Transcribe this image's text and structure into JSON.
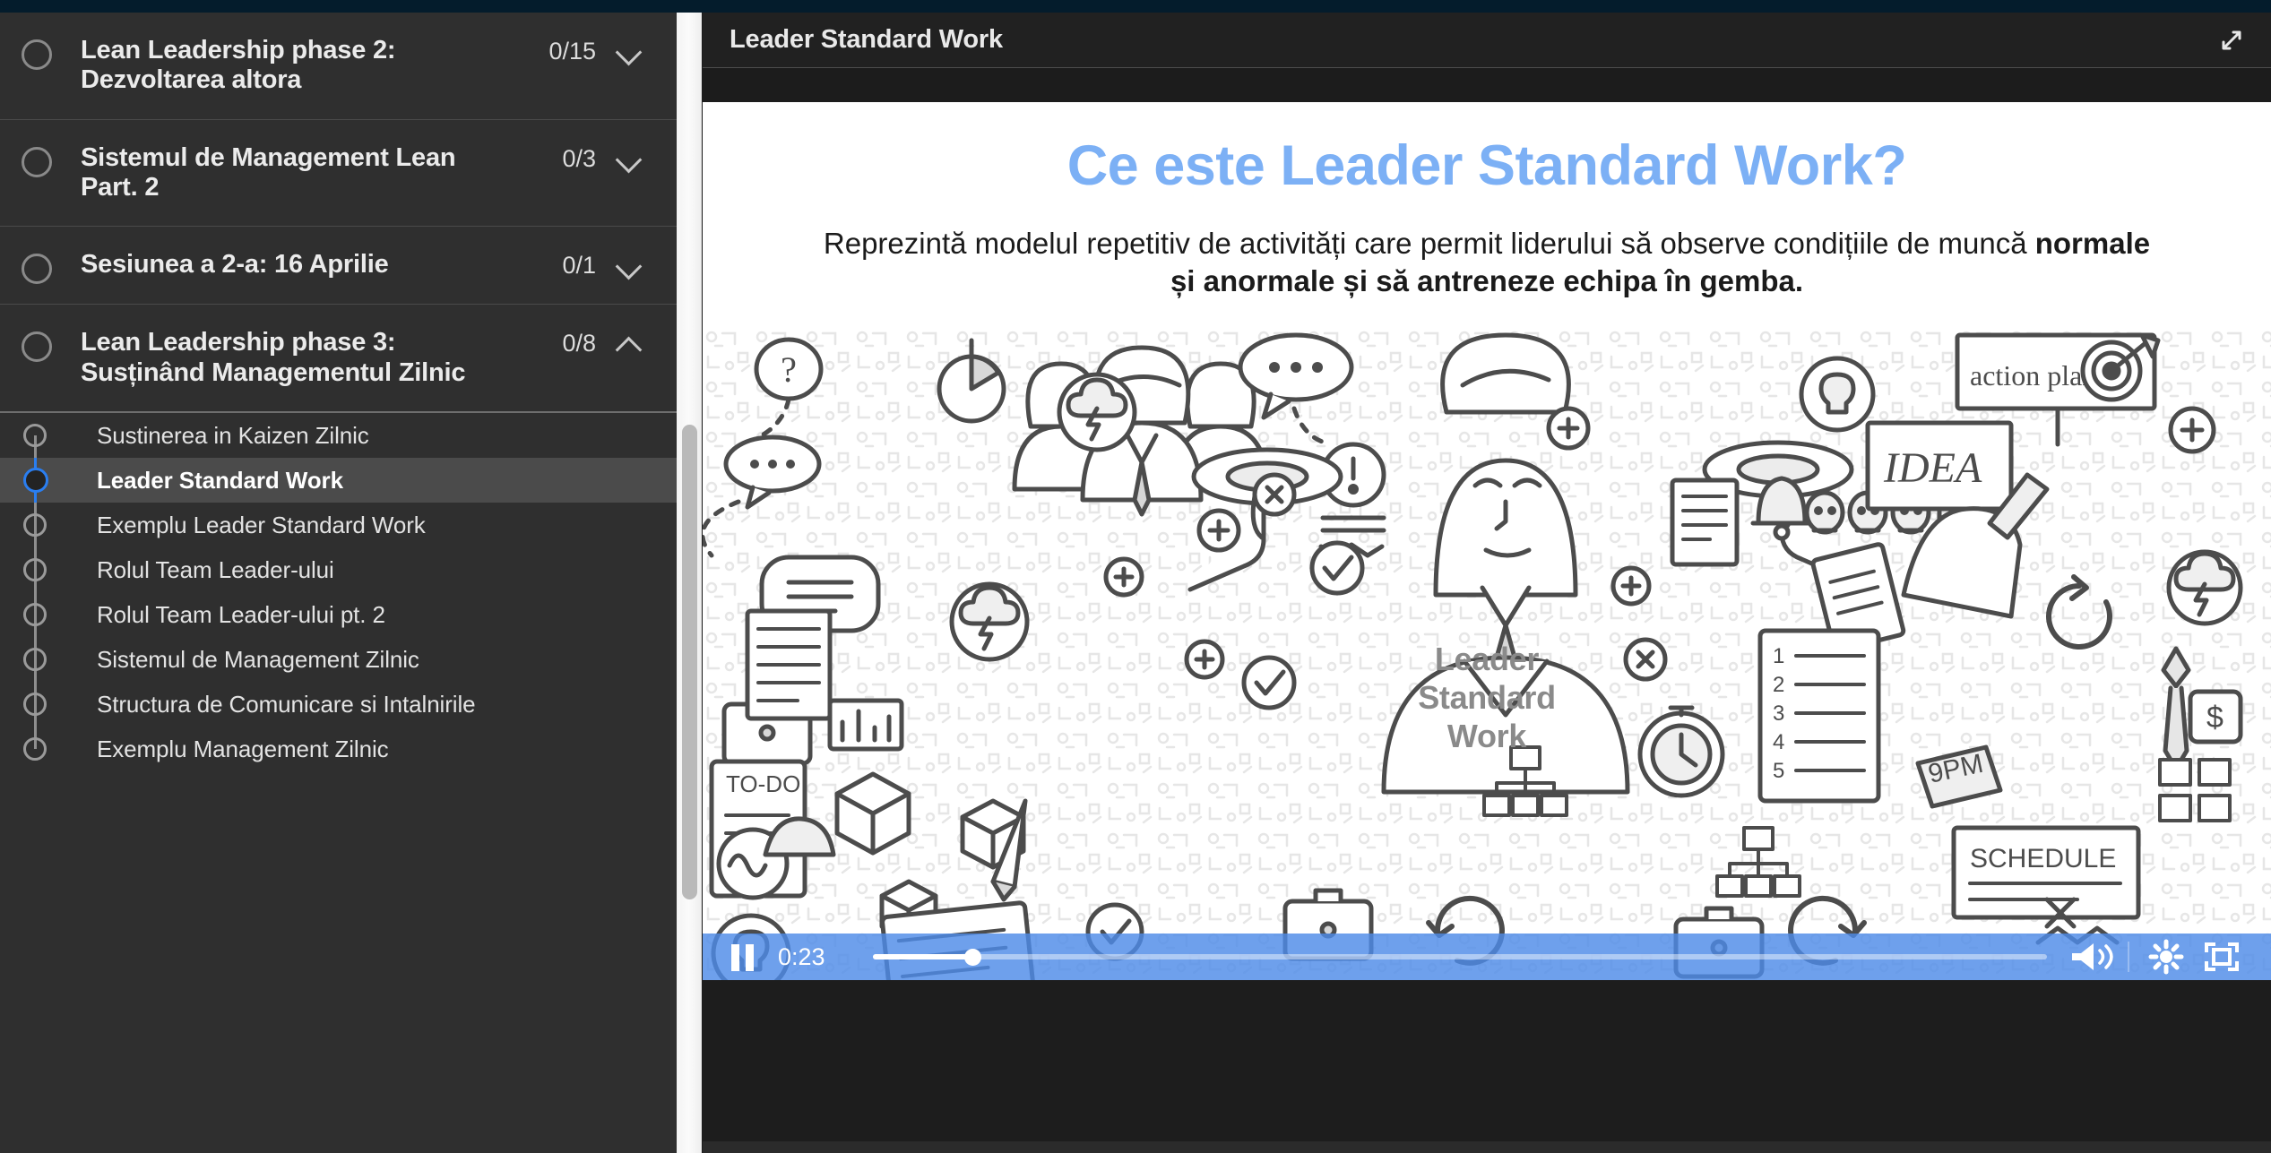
{
  "sidebar": {
    "modules": [
      {
        "title": "Lean Leadership phase 2: Dezvoltarea altora",
        "count": "0/15",
        "chevron": "chevron-down-icon",
        "expanded": false
      },
      {
        "title": "Sistemul de Management Lean Part. 2",
        "count": "0/3",
        "chevron": "chevron-down-icon",
        "expanded": false
      },
      {
        "title": "Sesiunea a 2-a: 16 Aprilie",
        "count": "0/1",
        "chevron": "chevron-down-icon",
        "expanded": false
      },
      {
        "title": "Lean Leadership phase 3: Susținând Managementul Zilnic",
        "count": "0/8",
        "chevron": "chevron-up-icon",
        "expanded": true
      }
    ],
    "lessons": [
      {
        "label": "Sustinerea in Kaizen Zilnic",
        "active": false
      },
      {
        "label": "Leader Standard Work",
        "active": true
      },
      {
        "label": "Exemplu Leader Standard Work",
        "active": false
      },
      {
        "label": "Rolul Team Leader-ului",
        "active": false
      },
      {
        "label": "Rolul Team Leader-ului pt. 2",
        "active": false
      },
      {
        "label": "Sistemul de Management Zilnic",
        "active": false
      },
      {
        "label": "Structura de Comunicare si Intalnirile",
        "active": false
      },
      {
        "label": "Exemplu Management Zilnic",
        "active": false
      }
    ],
    "scrollbar": {
      "name": "sidebar-scrollbar"
    }
  },
  "video": {
    "header_title": "Leader Standard Work",
    "expand_icon": "expand-diagonal-icon",
    "slide": {
      "title": "Ce este Leader Standard Work?",
      "body_prefix": "Reprezintă modelul repetitiv de activități care permit liderului să observe condițiile de muncă ",
      "body_bold": "normale și anormale și să antreneze echipa în gemba.",
      "center_line1": "Leader",
      "center_line2": "Standard",
      "center_line3": "Work",
      "illustration_labels": [
        "action plan",
        "IDEA",
        "TO-DO",
        "SCHEDULE",
        "9PM",
        "?"
      ]
    },
    "controls": {
      "play_icon": "pause-icon",
      "current_time": "0:23",
      "progress_percent": "8.5",
      "volume_icon": "volume-on-icon",
      "settings_icon": "gear-icon",
      "fullscreen_icon": "fullscreen-icon"
    }
  },
  "colors": {
    "accent_blue": "#2a7ef0",
    "player_blue": "#4e8be8",
    "title_blue": "#7cb0f5",
    "sidebar_bg": "#2f2f2f",
    "panel_bg": "#1d1d1d"
  }
}
